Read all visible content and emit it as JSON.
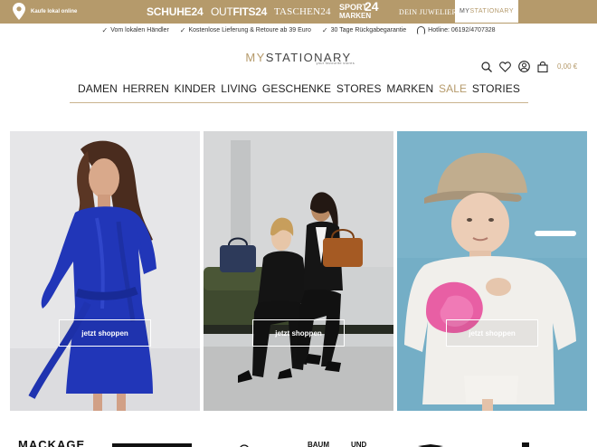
{
  "topbar": {
    "location_label": "Kaufe lokal online",
    "shops": {
      "schuhe": "SCHUHE24",
      "outfits_a": "OUT",
      "outfits_b": "FITS24",
      "taschen": "TASCHEN24",
      "sport_l1": "SPORT",
      "sport_l2": "MARKEN",
      "sport_num": "24",
      "juwelier": "DEIN JUWELIER",
      "mystationary_a": "MY",
      "mystationary_b": "STATIONARY"
    },
    "colors": {
      "gold": "#b59a6b"
    }
  },
  "usps": [
    "Vom lokalen Händler",
    "Kostenlose Lieferung & Retoure ab 39 Euro",
    "30 Tage Rückgabegarantie",
    "Hotline: 06192/4707328"
  ],
  "logo": {
    "my": "MY",
    "rest": "STATIONARY",
    "tagline": "your favourite stores"
  },
  "header": {
    "cart_total": "0,00 €",
    "icons": [
      "search-icon",
      "heart-icon",
      "user-icon",
      "cart-icon"
    ]
  },
  "nav": [
    "DAMEN",
    "HERREN",
    "KINDER",
    "LIVING",
    "GESCHENKE",
    "STORES",
    "MARKEN",
    "SALE",
    "STORIES"
  ],
  "hero": [
    {
      "button": "jetzt shoppen"
    },
    {
      "button": "jetzt shoppen"
    },
    {
      "button": "jetzt shoppen"
    }
  ],
  "brands": [
    "MACKAGE",
    "BAUM",
    "UND"
  ]
}
